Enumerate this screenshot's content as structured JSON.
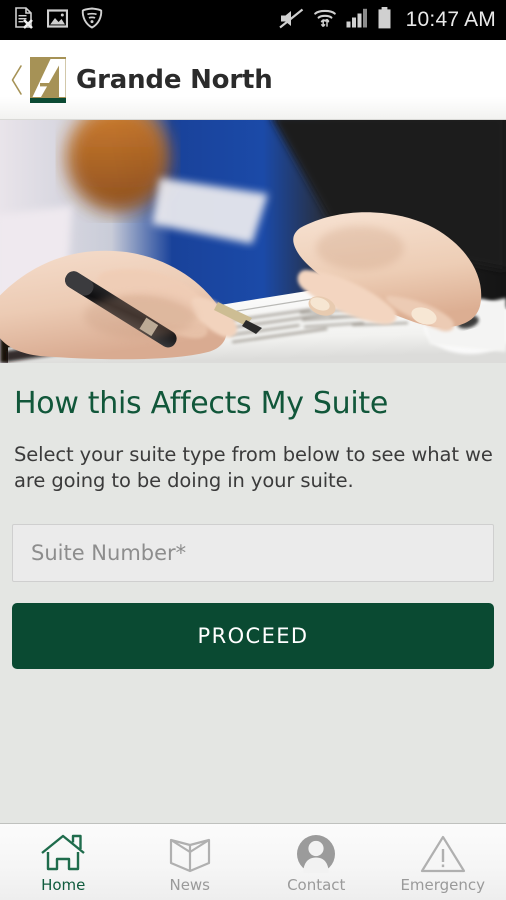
{
  "status_bar": {
    "time": "10:47 AM",
    "left_icons": [
      {
        "name": "document-error-icon",
        "glyph": "document-x"
      },
      {
        "name": "gallery-image-icon",
        "glyph": "image"
      },
      {
        "name": "wifi-shield-icon",
        "glyph": "shield-wifi"
      }
    ],
    "right_icons": [
      {
        "name": "mute-icon",
        "glyph": "speaker-muted"
      },
      {
        "name": "wifi-transfer-icon",
        "glyph": "wifi-arrows"
      },
      {
        "name": "cellular-signal-icon",
        "glyph": "signal-bars"
      },
      {
        "name": "battery-icon",
        "glyph": "battery-full"
      }
    ],
    "background_color": "#000000",
    "text_color": "#e9e9e9"
  },
  "header": {
    "back_label": "‹",
    "logo_letter": "A",
    "logo_background": "#a69256",
    "logo_accent": "#0c4a33",
    "title": "Grande North"
  },
  "hero": {
    "name": "document-signing-photo",
    "alt": "Two people signing a document with a pen"
  },
  "main": {
    "heading": "How this Affects My Suite",
    "heading_color": "#11573a",
    "description": "Select your suite type from below to see what we are going to be doing in your suite.",
    "suite_input": {
      "placeholder": "Suite Number*",
      "value": ""
    },
    "proceed_button": {
      "label": "PROCEED",
      "background": "#0a4a32",
      "text_color": "#ffffff"
    },
    "background_color": "#e4e6e3"
  },
  "bottom_nav": {
    "active_color": "#0f5b3d",
    "inactive_color": "#9a9a9a",
    "items": [
      {
        "label": "Home",
        "icon": "home-icon",
        "active": true
      },
      {
        "label": "News",
        "icon": "book-icon",
        "active": false
      },
      {
        "label": "Contact",
        "icon": "person-circle-icon",
        "active": false
      },
      {
        "label": "Emergency",
        "icon": "warning-triangle-icon",
        "active": false
      }
    ]
  }
}
